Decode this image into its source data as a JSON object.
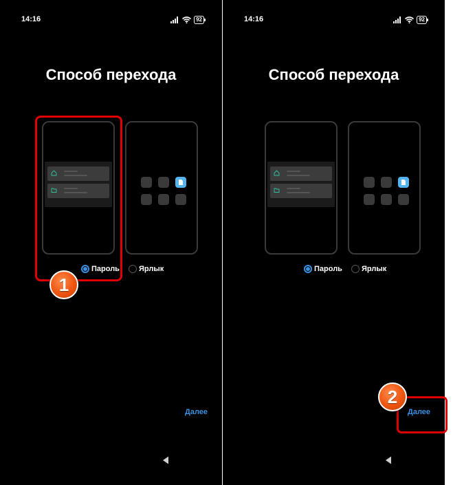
{
  "status": {
    "time": "14:16",
    "battery": "92"
  },
  "title": "Способ перехода",
  "options": {
    "password_label": "Пароль",
    "shortcut_label": "Ярлык"
  },
  "next_label": "Далее",
  "annotations": {
    "step1": "1",
    "step2": "2"
  },
  "colors": {
    "accent": "#3a8fe0",
    "highlight": "#e00000",
    "badge": "#ee5510",
    "tile_active": "#55b4f0"
  }
}
